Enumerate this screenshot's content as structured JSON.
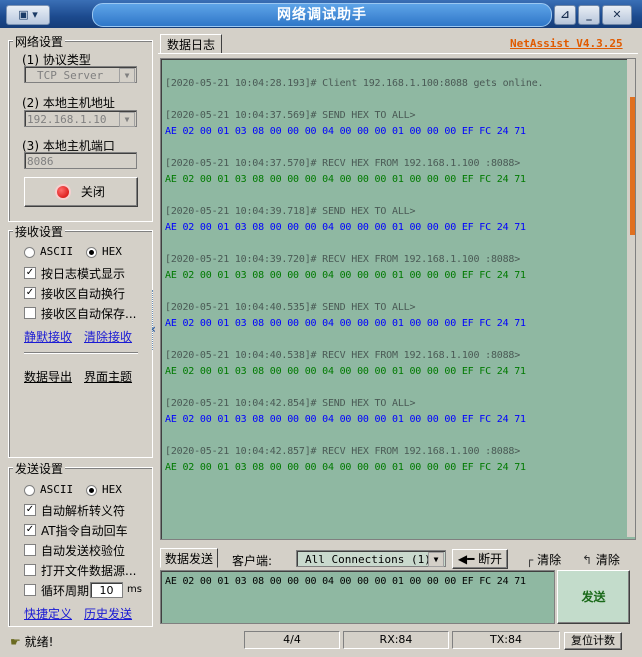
{
  "window": {
    "title": "网络调试助手",
    "sysmenu_label": "▾",
    "brand": "NetAssist V4.3.25",
    "colors": {
      "title_blue": "#2f77c8",
      "log_bg": "#8fb8a2",
      "send_blue": "#0000ff",
      "recv_green": "#007a00",
      "brand_orange": "#e05a00"
    }
  },
  "net_settings": {
    "title": "网络设置",
    "protocol_label": "(1) 协议类型",
    "protocol_value": "TCP Server",
    "host_label": "(2) 本地主机地址",
    "host_value": "192.168.1.10",
    "port_label": "(3) 本地主机端口",
    "port_value": "8086",
    "close_button": "关闭"
  },
  "recv_settings": {
    "title": "接收设置",
    "ascii": "ASCII",
    "hex": "HEX",
    "opt1": "按日志模式显示",
    "opt2": "接收区自动换行",
    "opt3": "接收区自动保存...",
    "link_silent": "静默接收",
    "link_clear": "清除接收",
    "link_export": "数据导出",
    "link_theme": "界面主题"
  },
  "send_settings": {
    "title": "发送设置",
    "ascii": "ASCII",
    "hex": "HEX",
    "opt1": "自动解析转义符",
    "opt2": "AT指令自动回车",
    "opt3": "自动发送校验位",
    "opt4": "打开文件数据源...",
    "opt5": "循环周期",
    "cycle_value": "10",
    "cycle_unit": "ms",
    "link_shortcut": "快捷定义",
    "link_history": "历史发送"
  },
  "log": {
    "tab": "数据日志",
    "lines": [
      {
        "text": "[2020-05-21 10:04:28.193]# Client 192.168.1.100:8088 gets online.",
        "kind": "head"
      },
      {
        "text": "[2020-05-21 10:04:37.569]# SEND HEX TO ALL>",
        "kind": "head"
      },
      {
        "text": "AE 02 00 01 03 08 00 00 00 04 00 00 00 01 00 00 00 EF FC 24 71",
        "kind": "send"
      },
      {
        "text": "[2020-05-21 10:04:37.570]# RECV HEX FROM 192.168.1.100 :8088>",
        "kind": "head"
      },
      {
        "text": "AE 02 00 01 03 08 00 00 00 04 00 00 00 01 00 00 00 EF FC 24 71",
        "kind": "recv"
      },
      {
        "text": "[2020-05-21 10:04:39.718]# SEND HEX TO ALL>",
        "kind": "head"
      },
      {
        "text": "AE 02 00 01 03 08 00 00 00 04 00 00 00 01 00 00 00 EF FC 24 71",
        "kind": "send"
      },
      {
        "text": "[2020-05-21 10:04:39.720]# RECV HEX FROM 192.168.1.100 :8088>",
        "kind": "head"
      },
      {
        "text": "AE 02 00 01 03 08 00 00 00 04 00 00 00 01 00 00 00 EF FC 24 71",
        "kind": "recv"
      },
      {
        "text": "[2020-05-21 10:04:40.535]# SEND HEX TO ALL>",
        "kind": "head"
      },
      {
        "text": "AE 02 00 01 03 08 00 00 00 04 00 00 00 01 00 00 00 EF FC 24 71",
        "kind": "send"
      },
      {
        "text": "[2020-05-21 10:04:40.538]# RECV HEX FROM 192.168.1.100 :8088>",
        "kind": "head"
      },
      {
        "text": "AE 02 00 01 03 08 00 00 00 04 00 00 00 01 00 00 00 EF FC 24 71",
        "kind": "recv"
      },
      {
        "text": "[2020-05-21 10:04:42.854]# SEND HEX TO ALL>",
        "kind": "head"
      },
      {
        "text": "AE 02 00 01 03 08 00 00 00 04 00 00 00 01 00 00 00 EF FC 24 71",
        "kind": "send"
      },
      {
        "text": "[2020-05-21 10:04:42.857]# RECV HEX FROM 192.168.1.100 :8088>",
        "kind": "head"
      },
      {
        "text": "AE 02 00 01 03 08 00 00 00 04 00 00 00 01 00 00 00 EF FC 24 71",
        "kind": "recv"
      }
    ]
  },
  "send_area": {
    "tab": "数据发送",
    "client_label": "客户端:",
    "client_value": "All Connections (1)",
    "disconnect": "断开",
    "clear1": "清除",
    "clear2": "清除",
    "payload": "AE 02 00 01 03 08 00 00 00 04 00 00 00 01 00 00 00 EF FC 24 71",
    "send_button": "发送"
  },
  "status": {
    "ready": "就绪!",
    "count": "4/4",
    "rx": "RX:84",
    "tx": "TX:84",
    "reset": "复位计数"
  }
}
